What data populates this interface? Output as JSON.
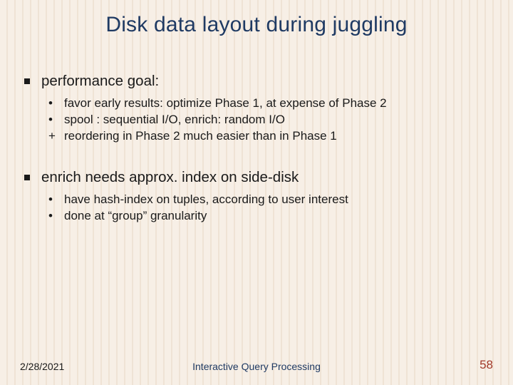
{
  "title": "Disk data layout during juggling",
  "sections": [
    {
      "heading": "performance goal:",
      "items": [
        {
          "bullet": "•",
          "text": "favor early results: optimize Phase 1, at expense of Phase 2"
        },
        {
          "bullet": "•",
          "text": "spool : sequential I/O, enrich: random I/O"
        },
        {
          "bullet": "+",
          "text": "reordering in Phase 2 much easier than in Phase 1"
        }
      ]
    },
    {
      "heading": "enrich needs approx. index on side-disk",
      "items": [
        {
          "bullet": "•",
          "text": "have hash-index on tuples, according to user interest"
        },
        {
          "bullet": "•",
          "text": "done at “group” granularity"
        }
      ]
    }
  ],
  "footer": {
    "date": "2/28/2021",
    "center": "Interactive Query Processing",
    "page": "58"
  }
}
